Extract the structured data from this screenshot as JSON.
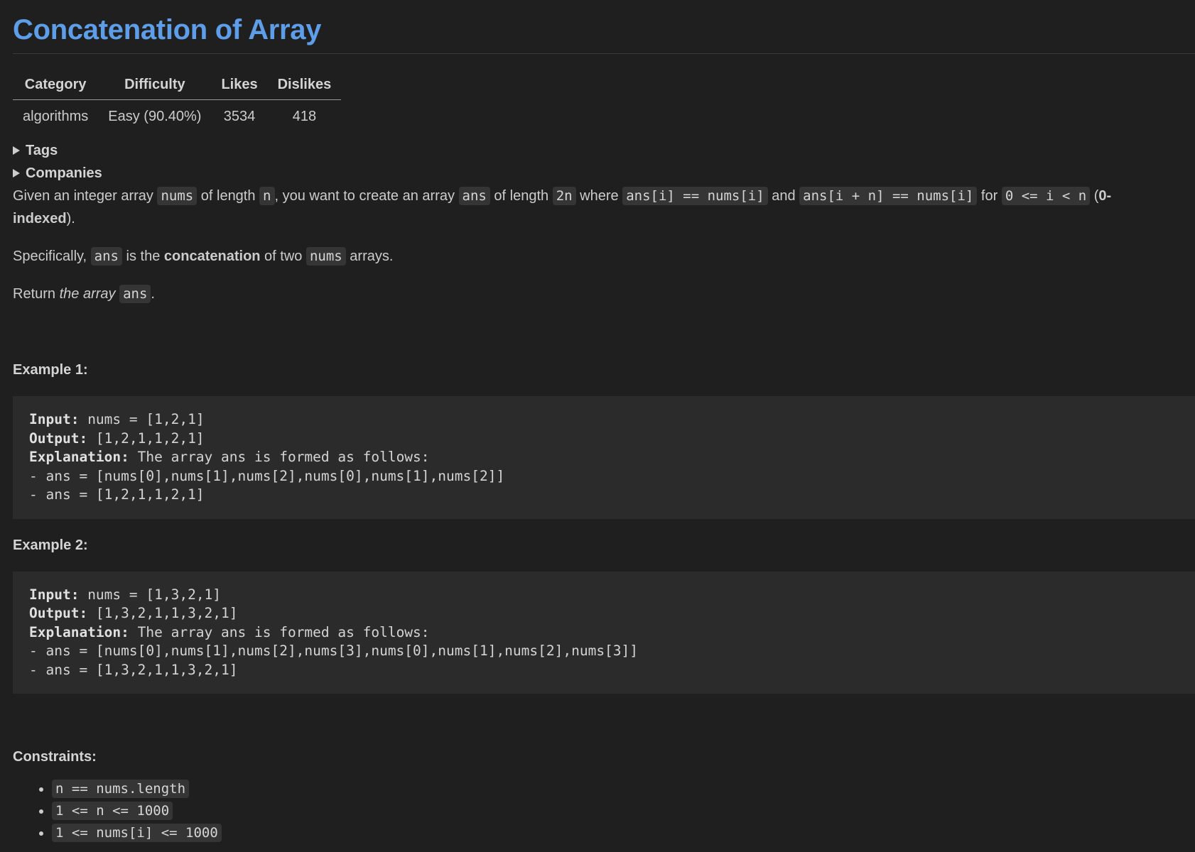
{
  "title": "Concatenation of Array",
  "meta_table": {
    "headers": [
      "Category",
      "Difficulty",
      "Likes",
      "Dislikes"
    ],
    "row": [
      "algorithms",
      "Easy (90.40%)",
      "3534",
      "418"
    ]
  },
  "details": {
    "tags_label": "Tags",
    "companies_label": "Companies"
  },
  "description": {
    "p1": {
      "t1": "Given an integer array ",
      "c1": "nums",
      "t2": " of length ",
      "c2": "n",
      "t3": ", you want to create an array ",
      "c3": "ans",
      "t4": " of length ",
      "c4": "2n",
      "t5": " where ",
      "c5": "ans[i] == nums[i]",
      "t6": " and ",
      "c6": "ans[i + n] == nums[i]",
      "t7": " for ",
      "c7": "0 <= i < n",
      "t8": " (",
      "b1": "0-indexed",
      "t9": ")."
    },
    "p2": {
      "t1": "Specifically, ",
      "c1": "ans",
      "t2": " is the ",
      "b1": "concatenation",
      "t3": " of two ",
      "c2": "nums",
      "t4": " arrays."
    },
    "p3": {
      "t1": "Return ",
      "i1": "the array",
      "t2": " ",
      "c1": "ans",
      "t3": "."
    }
  },
  "examples": [
    {
      "title": "Example 1:",
      "input_label": "Input:",
      "input": " nums = [1,2,1]",
      "output_label": "Output:",
      "output": " [1,2,1,1,2,1]",
      "explanation_label": "Explanation:",
      "explanation": " The array ans is formed as follows:",
      "line1": "- ans = [nums[0],nums[1],nums[2],nums[0],nums[1],nums[2]]",
      "line2": "- ans = [1,2,1,1,2,1]"
    },
    {
      "title": "Example 2:",
      "input_label": "Input:",
      "input": " nums = [1,3,2,1]",
      "output_label": "Output:",
      "output": " [1,3,2,1,1,3,2,1]",
      "explanation_label": "Explanation:",
      "explanation": " The array ans is formed as follows:",
      "line1": "- ans = [nums[0],nums[1],nums[2],nums[3],nums[0],nums[1],nums[2],nums[3]]",
      "line2": "- ans = [1,3,2,1,1,3,2,1]"
    }
  ],
  "constraints": {
    "title": "Constraints:",
    "items": [
      "n == nums.length",
      "1 <= n <= 1000",
      "1 <= nums[i] <= 1000"
    ]
  },
  "colors": {
    "background": "#1f1f1f",
    "title": "#5e9ee8",
    "code_background": "#353535",
    "pre_background": "#2b2b2b"
  }
}
